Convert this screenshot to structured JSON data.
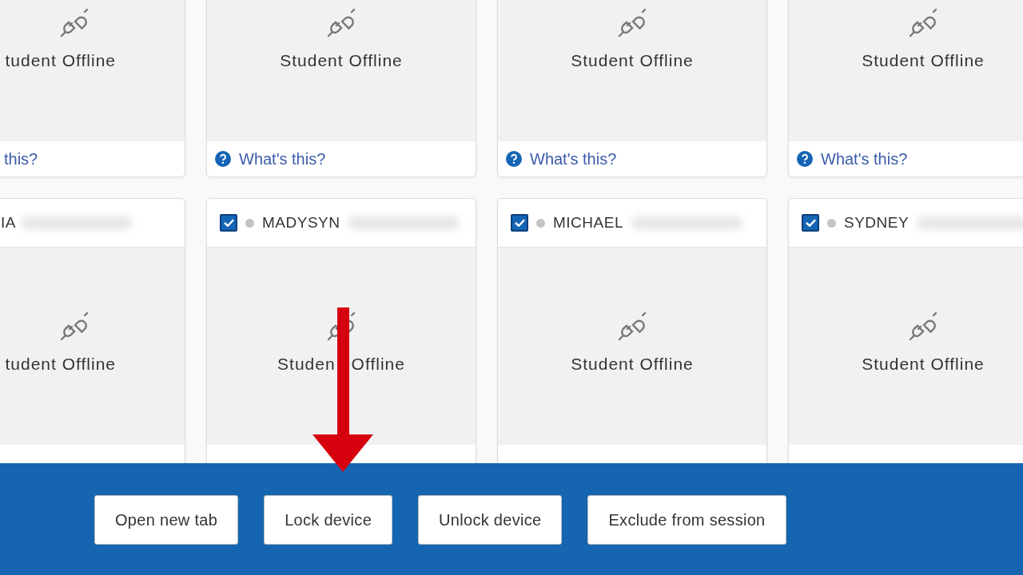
{
  "card_rows": [
    {
      "cards": [
        {
          "status": "tudent Offline",
          "help": "this?"
        },
        {
          "status": "Student Offline",
          "help": "What's this?"
        },
        {
          "status": "Student Offline",
          "help": "What's this?"
        },
        {
          "status": "Student Offline",
          "help": "What's this?"
        }
      ]
    },
    {
      "cards": [
        {
          "name": "IA",
          "status": "tudent Offline"
        },
        {
          "checked": true,
          "name": "MADYSYN",
          "online": false,
          "status": "Studen",
          "status_after": "Offline"
        },
        {
          "checked": true,
          "name": "MICHAEL",
          "online": false,
          "status": "Student Offline"
        },
        {
          "checked": true,
          "name": "SYDNEY",
          "online": false,
          "status": "Student Offline"
        }
      ]
    }
  ],
  "action_bar": {
    "buttons": [
      "Open new tab",
      "Lock device",
      "Unlock device",
      "Exclude from session"
    ]
  }
}
